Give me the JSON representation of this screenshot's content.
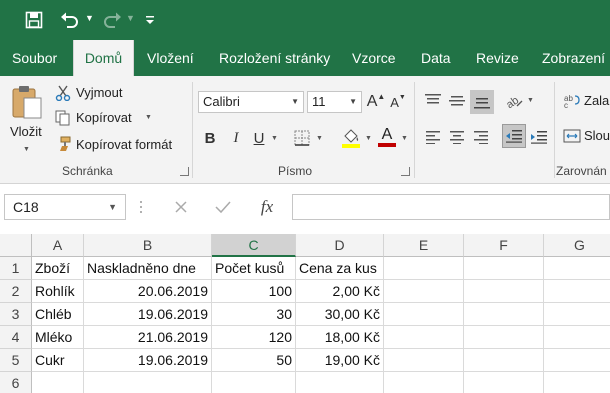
{
  "qat": {
    "save_icon": "save-icon",
    "undo_icon": "undo-icon",
    "redo_icon": "redo-icon",
    "customize_icon": "customize-qat-icon"
  },
  "tabs": [
    {
      "label": "Soubor"
    },
    {
      "label": "Domů",
      "active": true
    },
    {
      "label": "Vložení"
    },
    {
      "label": "Rozložení stránky"
    },
    {
      "label": "Vzorce"
    },
    {
      "label": "Data"
    },
    {
      "label": "Revize"
    },
    {
      "label": "Zobrazení"
    }
  ],
  "ribbon": {
    "clipboard": {
      "paste_label": "Vložit",
      "cut_label": "Vyjmout",
      "copy_label": "Kopírovat",
      "format_painter_label": "Kopírovat formát",
      "group_label": "Schránka"
    },
    "font": {
      "font_name": "Calibri",
      "font_size": "11",
      "group_label": "Písmo",
      "bold": "B",
      "italic": "I",
      "underline": "U",
      "font_color": "A",
      "grow": "A",
      "shrink": "A"
    },
    "alignment": {
      "wrap_label": "Zala",
      "merge_label": "Slou",
      "group_label": "Zarovnán"
    }
  },
  "formula_bar": {
    "name_box": "C18",
    "fx": "fx",
    "value": ""
  },
  "columns": [
    "A",
    "B",
    "C",
    "D",
    "E",
    "F",
    "G"
  ],
  "selected_column": "C",
  "rows": [
    {
      "num": "1",
      "cells": [
        "Zboží",
        "Naskladněno dne",
        "Počet kusů",
        "Cena za kus",
        "",
        "",
        ""
      ]
    },
    {
      "num": "2",
      "cells": [
        "Rohlík",
        "20.06.2019",
        "100",
        "2,00 Kč",
        "",
        "",
        ""
      ]
    },
    {
      "num": "3",
      "cells": [
        "Chléb",
        "19.06.2019",
        "30",
        "30,00 Kč",
        "",
        "",
        ""
      ]
    },
    {
      "num": "4",
      "cells": [
        "Mléko",
        "21.06.2019",
        "120",
        "18,00 Kč",
        "",
        "",
        ""
      ]
    },
    {
      "num": "5",
      "cells": [
        "Cukr",
        "19.06.2019",
        "50",
        "19,00 Kč",
        "",
        "",
        ""
      ]
    },
    {
      "num": "6",
      "cells": [
        "",
        "",
        "",
        "",
        "",
        "",
        ""
      ]
    }
  ],
  "colors": {
    "brand": "#217346",
    "font_highlight": "#ffff00",
    "font_color": "#c00000"
  }
}
